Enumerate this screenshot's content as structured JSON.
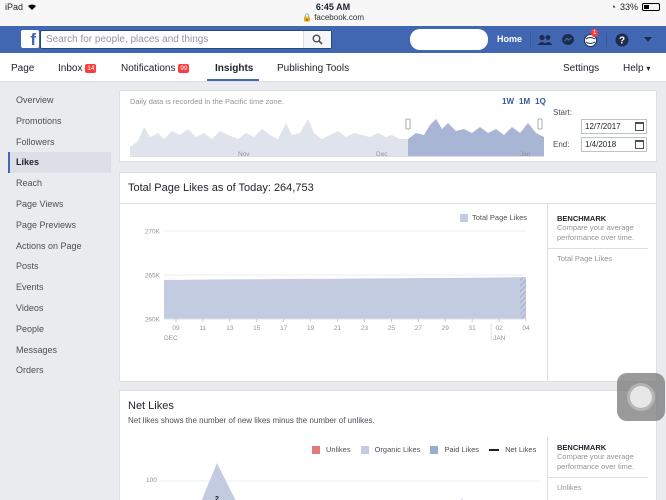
{
  "status_bar": {
    "device": "iPad",
    "time": "6:45 AM",
    "url": "facebook.com",
    "battery": "33%"
  },
  "topbar": {
    "logo": "f",
    "search_placeholder": "Search for people, places and things",
    "home": "Home",
    "notifications_badge": "1",
    "colors": {
      "bar": "#4267b2"
    }
  },
  "page_tabs": {
    "page": "Page",
    "inbox": "Inbox",
    "inbox_count": "14",
    "notifications": "Notifications",
    "notifications_count": "99",
    "insights": "Insights",
    "publishing_tools": "Publishing Tools",
    "settings": "Settings",
    "help": "Help"
  },
  "sidebar": {
    "items": [
      "Overview",
      "Promotions",
      "Followers",
      "Likes",
      "Reach",
      "Page Views",
      "Page Previews",
      "Actions on Page",
      "Posts",
      "Events",
      "Videos",
      "People",
      "Messages",
      "Orders"
    ],
    "active": "Likes"
  },
  "range": {
    "note": "Daily data is recorded in the Pacific time zone.",
    "buttons": [
      "1W",
      "1M",
      "1Q"
    ],
    "start_label": "Start:",
    "start_value": "12/7/2017",
    "end_label": "End:",
    "end_value": "1/4/2018",
    "month_labels": [
      "Nov",
      "Dec",
      "Jan"
    ]
  },
  "total_likes": {
    "title": "Total Page Likes as of Today: 264,753",
    "legend": "Total Page Likes",
    "benchmark_title": "BENCHMARK",
    "benchmark_desc": "Compare your average performance over time.",
    "benchmark_item": "Total Page Likes"
  },
  "net_likes": {
    "title": "Net Likes",
    "subtitle": "Net likes shows the number of new likes minus the number of unlikes.",
    "legend": [
      "Unlikes",
      "Organic Likes",
      "Paid Likes",
      "Net Likes"
    ],
    "legend_colors": [
      "#e07a7a",
      "#c3cbe0",
      "#9aabd4",
      "#1d2129"
    ],
    "benchmark_title": "BENCHMARK",
    "benchmark_desc": "Compare your average performance over time.",
    "benchmark_item": "Unlikes",
    "y_tick": "100",
    "peak_label": "2"
  },
  "chart_data": [
    {
      "type": "area",
      "title": "Total Page Likes",
      "x": [
        "09",
        "11",
        "13",
        "15",
        "17",
        "19",
        "21",
        "23",
        "25",
        "27",
        "29",
        "31",
        "02",
        "04"
      ],
      "x_group_labels": [
        "DEC",
        "JAN"
      ],
      "y_ticks": [
        "270K",
        "265K",
        "260K"
      ],
      "ylim": [
        260000,
        270000
      ],
      "series": [
        {
          "name": "Total Page Likes",
          "values": [
            264450,
            264480,
            264500,
            264520,
            264540,
            264560,
            264580,
            264600,
            264620,
            264640,
            264660,
            264690,
            264720,
            264753
          ]
        }
      ],
      "color": "#c3cbe0"
    }
  ]
}
